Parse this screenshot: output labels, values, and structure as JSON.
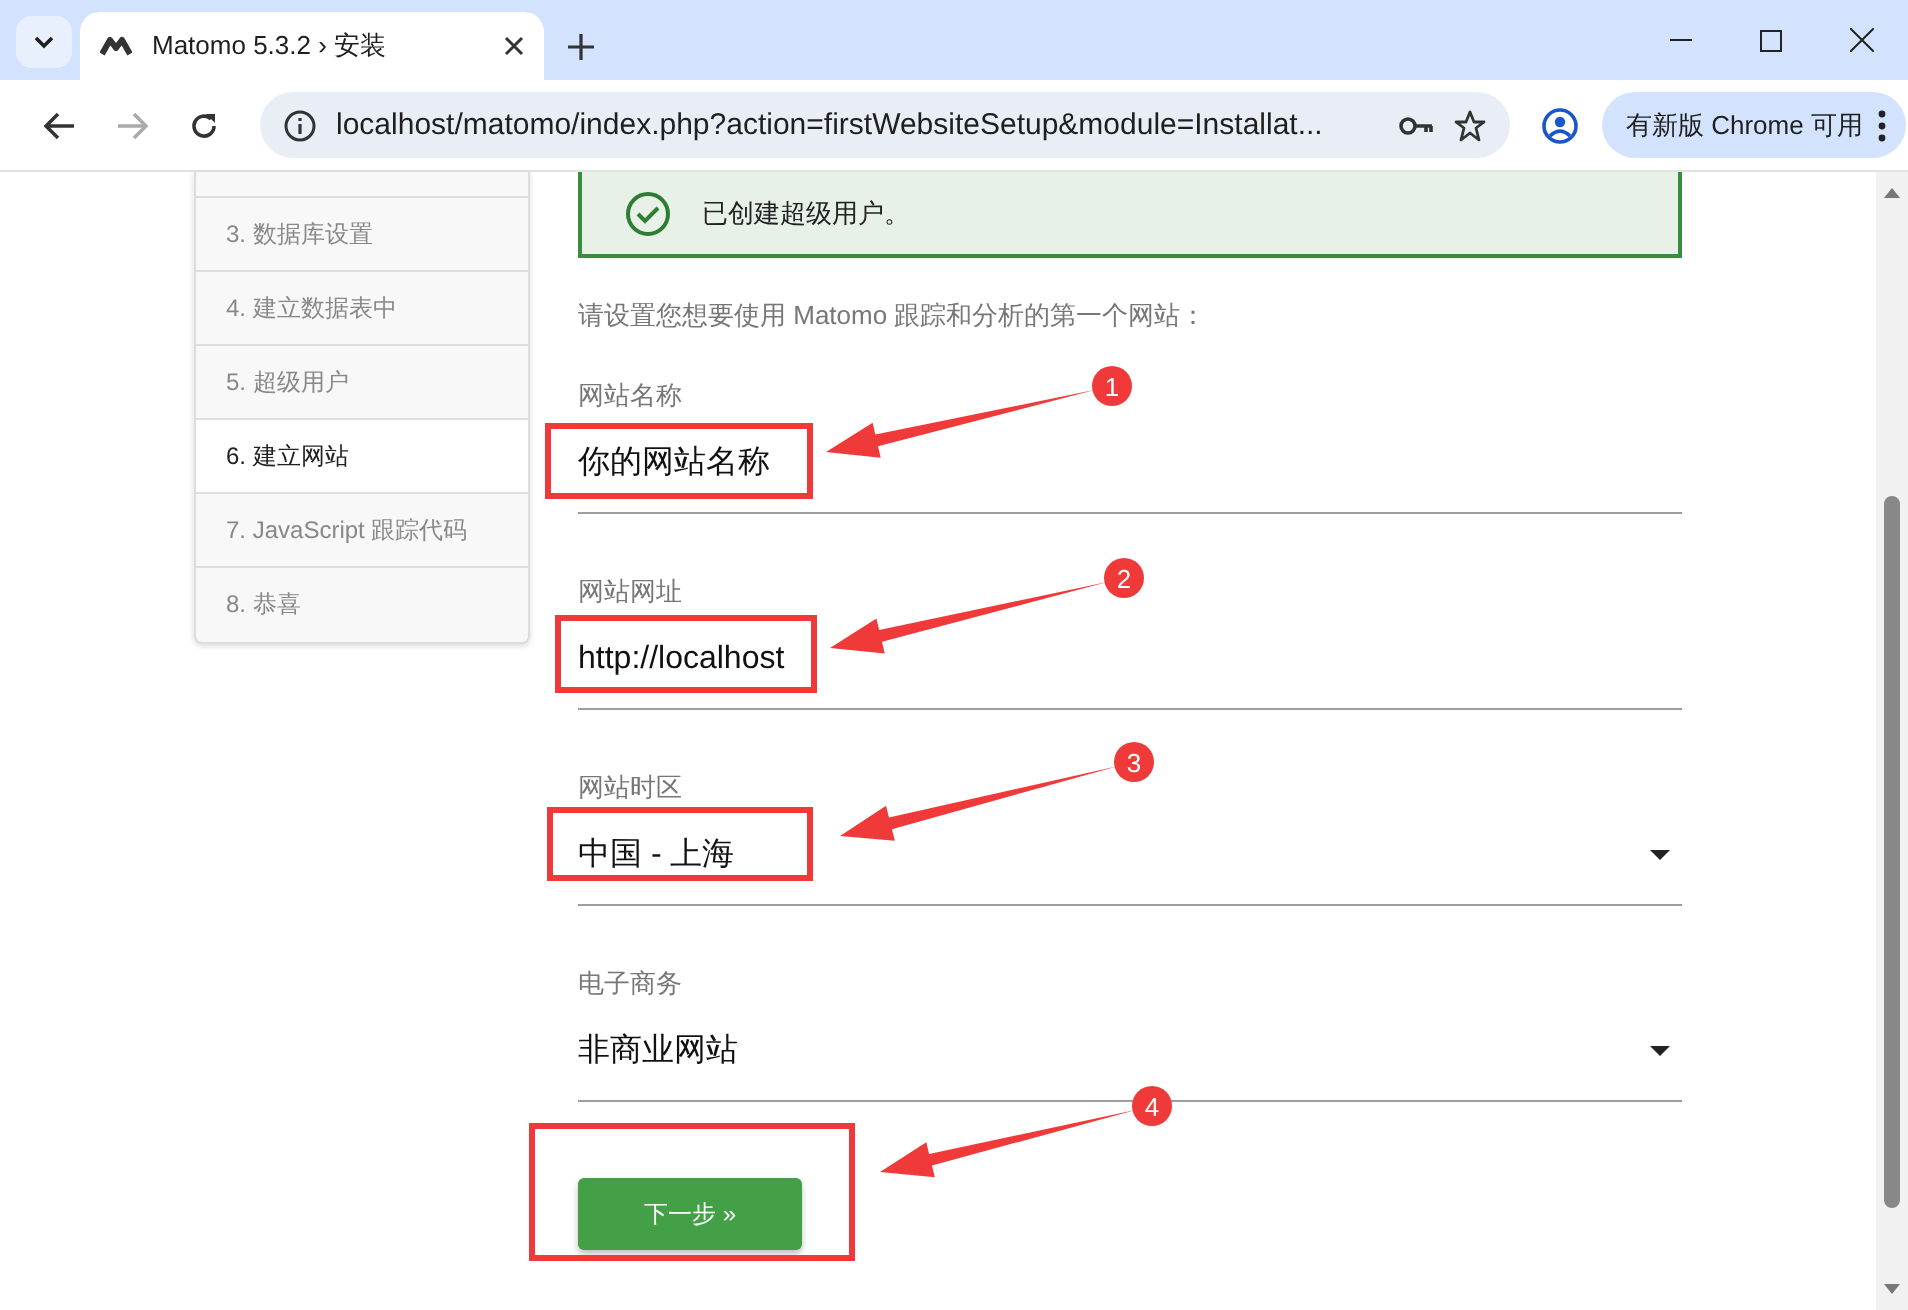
{
  "browser": {
    "tab_title": "Matomo 5.3.2 › 安装",
    "url": "localhost/matomo/index.php?action=firstWebsiteSetup&module=Installat...",
    "update_button": "有新版 Chrome 可用"
  },
  "steps": [
    {
      "label": "3. 数据库设置",
      "selected": false
    },
    {
      "label": "4. 建立数据表中",
      "selected": false
    },
    {
      "label": "5. 超级用户",
      "selected": false
    },
    {
      "label": "6. 建立网站",
      "selected": true
    },
    {
      "label": "7. JavaScript 跟踪代码",
      "selected": false
    },
    {
      "label": "8. 恭喜",
      "selected": false
    }
  ],
  "success_message": "已创建超级用户。",
  "intro": "请设置您想要使用 Matomo 跟踪和分析的第一个网站：",
  "fields": [
    {
      "kind": "text",
      "label": "网站名称",
      "value": "你的网站名称"
    },
    {
      "kind": "text",
      "label": "网站网址",
      "value": "http://localhost"
    },
    {
      "kind": "select",
      "label": "网站时区",
      "value": "中国 - 上海"
    },
    {
      "kind": "select",
      "label": "电子商务",
      "value": "非商业网站"
    }
  ],
  "next_button": "下一步 »",
  "annotations": [
    {
      "number": "1"
    },
    {
      "number": "2"
    },
    {
      "number": "3"
    },
    {
      "number": "4"
    }
  ]
}
